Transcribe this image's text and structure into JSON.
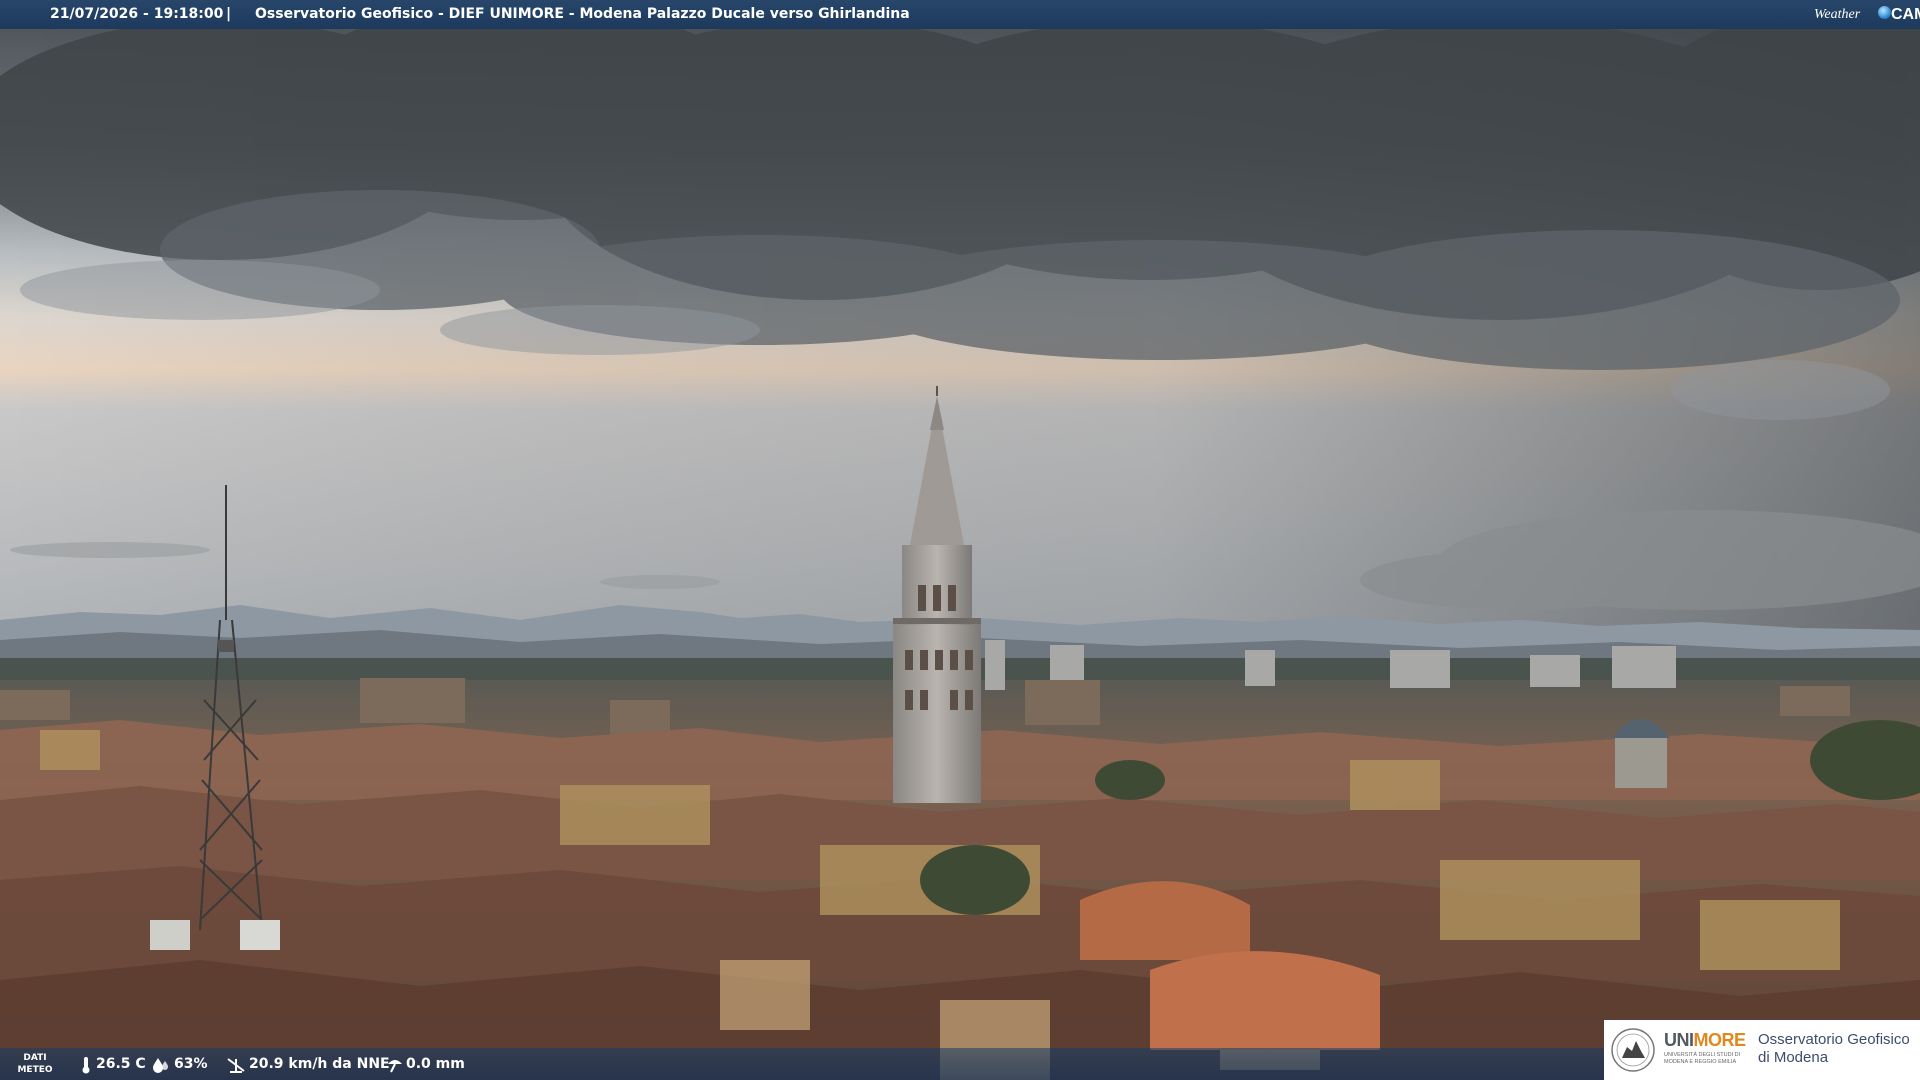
{
  "header": {
    "timestamp": "21/07/2026 - 19:18:00",
    "separator": "|",
    "title": "Osservatorio Geofisico - DIEF UNIMORE - Modena Palazzo Ducale verso Ghirlandina"
  },
  "brand": {
    "weather_label": "Weather",
    "cam_label": "CAM",
    "accent_color": "#2f8fd6"
  },
  "weather": {
    "label_line1": "DATI",
    "label_line2": "METEO",
    "temperature": "26.5 C",
    "humidity": "63%",
    "wind": "20.9 km/h da NNE",
    "rain": "0.0 mm",
    "icons": [
      "thermometer-icon",
      "humidity-drop-icon",
      "wind-icon",
      "rain-gauge-icon"
    ]
  },
  "logo": {
    "university_part1": "UNI",
    "university_part2": "MORE",
    "university_sub_line1": "UNIVERSITÀ DEGLI STUDI DI",
    "university_sub_line2": "MODENA E REGGIO EMILIA",
    "observatory_line1": "Osservatorio Geofisico",
    "observatory_line2": "di Modena"
  },
  "colors": {
    "bar_blue": "#1d3a5d",
    "logo_orange": "#e0881e",
    "roof_terracotta": "#8a5a45"
  }
}
